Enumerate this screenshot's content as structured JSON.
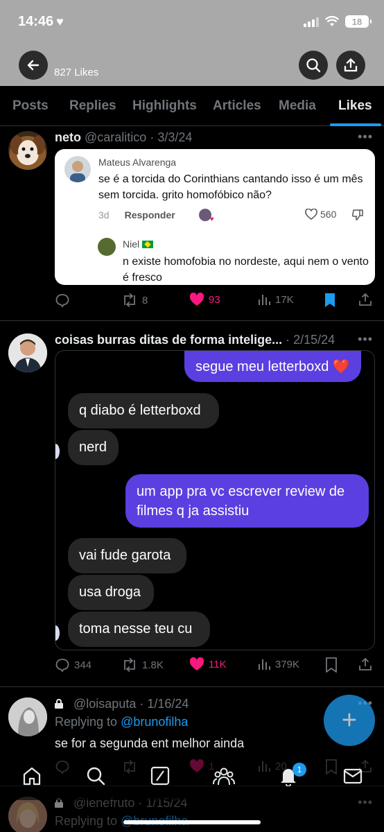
{
  "status_bar": {
    "time": "14:46",
    "battery": "18"
  },
  "header": {
    "likes_count": "827 Likes"
  },
  "tabs": [
    {
      "label": "Posts"
    },
    {
      "label": "Replies"
    },
    {
      "label": "Highlights"
    },
    {
      "label": "Articles"
    },
    {
      "label": "Media"
    },
    {
      "label": "Likes",
      "active": true
    }
  ],
  "posts": [
    {
      "name": "neto",
      "handle": "@caralitico",
      "date": "3/3/24",
      "embed": {
        "commenter": "Mateus Alvarenga",
        "text": "se é a torcida do Corinthians cantando isso é um mês sem torcida. grito homofóbico não?",
        "age": "3d",
        "reply_label": "Responder",
        "likes": "560",
        "reply_name": "Niel",
        "reply_text": "n existe homofobia no nordeste, aqui nem o vento é fresco"
      },
      "stats": {
        "reposts": "8",
        "likes": "93",
        "views": "17K"
      }
    },
    {
      "name": "coisas burras ditas de forma intelige...",
      "date": "2/15/24",
      "chat": [
        {
          "text": "segue meu letterboxd ❤️"
        },
        {
          "text": "q diabo é letterboxd"
        },
        {
          "text": "nerd"
        },
        {
          "text": "um app pra vc escrever review de filmes q ja assistiu"
        },
        {
          "text": "vai fude garota"
        },
        {
          "text": "usa droga"
        },
        {
          "text": "toma nesse teu cu"
        }
      ],
      "stats": {
        "replies": "344",
        "reposts": "1.8K",
        "likes": "11K",
        "views": "379K"
      }
    },
    {
      "handle": "@loisaputa",
      "date": "1/16/24",
      "replying_prefix": "Replying to",
      "replying_to": "@brunofilha",
      "text": "se for a segunda ent melhor ainda",
      "stats": {
        "likes": "1",
        "views": "20"
      }
    },
    {
      "handle": "@lenefruto",
      "date": "1/15/24",
      "replying_prefix": "Replying to",
      "replying_to": "@brunofilha"
    }
  ],
  "bottom_nav": {
    "notifications_badge": "1"
  },
  "colors": {
    "accent": "#1d9bf0",
    "like": "#f91880",
    "chat_out": "#5b3fe0",
    "header_bg": "#a9a9a9"
  }
}
